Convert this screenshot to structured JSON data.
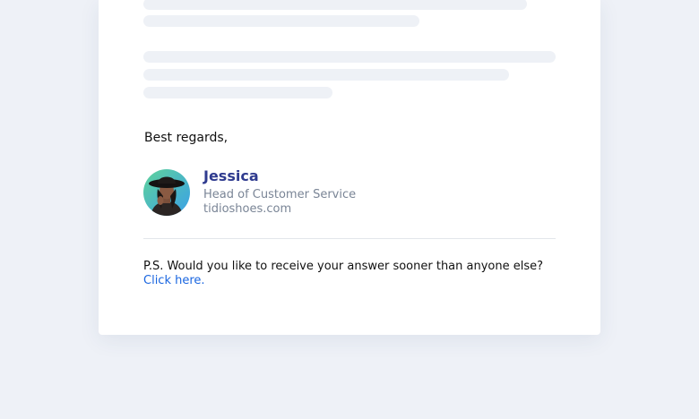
{
  "email": {
    "closing": "Best regards,",
    "signature": {
      "name": "Jessica",
      "role": "Head of Customer Service",
      "website": "tidioshoes.com",
      "avatar_icon": "user-avatar-icon"
    },
    "ps": {
      "text": "P.S. Would you like to receive your answer sooner than anyone else?",
      "link_label": "Click here."
    }
  },
  "colors": {
    "background": "#eef1f7",
    "card": "#ffffff",
    "skeleton": "#eef1f6",
    "name": "#2f3b8f",
    "muted": "#7a8596",
    "link": "#1a66e0"
  }
}
